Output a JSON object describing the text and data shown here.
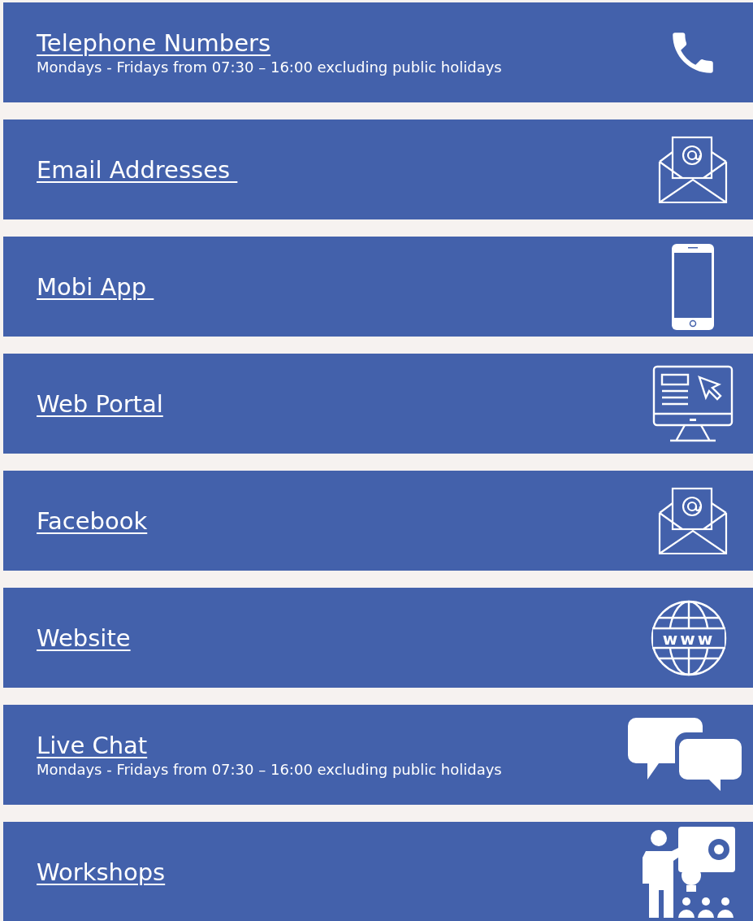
{
  "cards": [
    {
      "kind": "phone",
      "title": "Telephone Numbers",
      "subtitle": "Mondays - Fridays from 07:30 – 16:00 excluding public holidays"
    },
    {
      "kind": "email",
      "title": "Email Addresses "
    },
    {
      "kind": "mobile",
      "title": "Mobi App "
    },
    {
      "kind": "portal",
      "title": "Web Portal"
    },
    {
      "kind": "email",
      "title": "Facebook"
    },
    {
      "kind": "globe",
      "title": "Website",
      "icon_label": "www"
    },
    {
      "kind": "chat",
      "title": "Live Chat",
      "subtitle": "Mondays - Fridays from 07:30 – 16:00 excluding public holidays"
    },
    {
      "kind": "workshop",
      "title": "Workshops"
    }
  ]
}
